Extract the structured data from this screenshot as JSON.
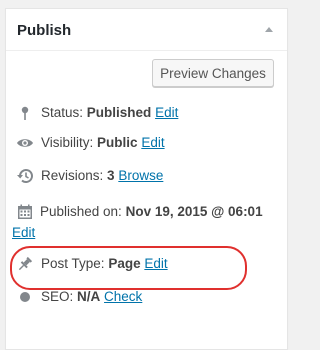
{
  "panel": {
    "title": "Publish",
    "toggle_icon": "triangle-up-icon"
  },
  "actions": {
    "preview_label": "Preview Changes"
  },
  "status": {
    "icon": "pin-icon",
    "label": "Status:",
    "value": "Published",
    "link": "Edit"
  },
  "visibility": {
    "icon": "eye-icon",
    "label": "Visibility:",
    "value": "Public",
    "link": "Edit"
  },
  "revisions": {
    "icon": "history-icon",
    "label": "Revisions:",
    "value": "3",
    "link": "Browse"
  },
  "published_on": {
    "icon": "calendar-icon",
    "label": "Published on:",
    "value": "Nov 19, 2015 @ 06:01",
    "link": "Edit"
  },
  "post_type": {
    "icon": "thumbtack-icon",
    "label": "Post Type:",
    "value": "Page",
    "link": "Edit"
  },
  "seo": {
    "icon": "dot-icon",
    "label": "SEO:",
    "value": "N/A",
    "link": "Check"
  },
  "colors": {
    "link": "#0073aa",
    "highlight": "#e0302e",
    "text": "#444444",
    "icon": "#82878c"
  }
}
